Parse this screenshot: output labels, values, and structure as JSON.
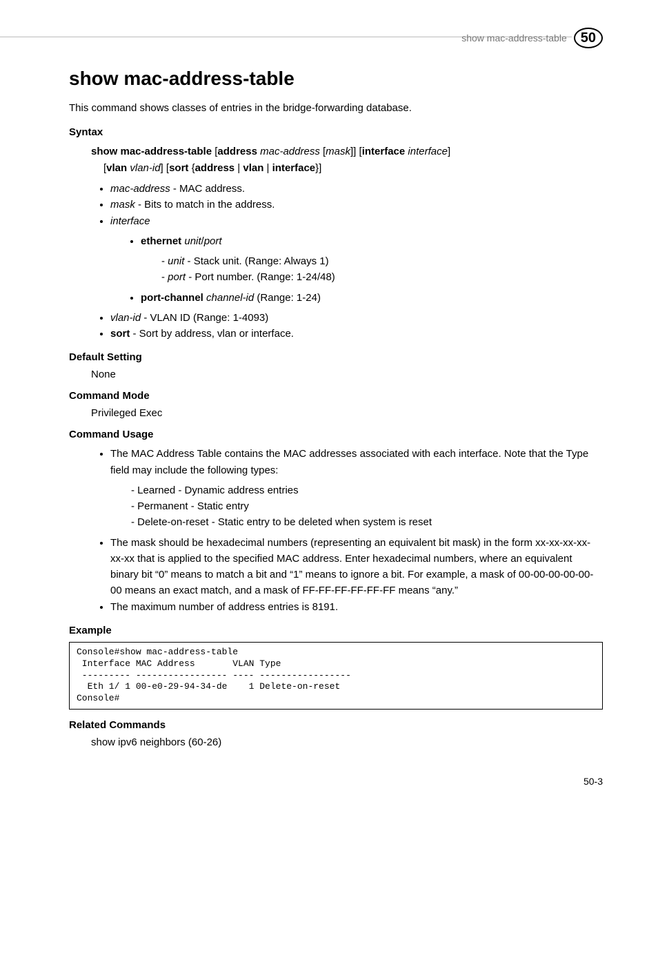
{
  "header": {
    "running_title": "show mac-address-table",
    "chapter_number": "50"
  },
  "title": "show mac-address-table",
  "intro": "This command shows classes of entries in the bridge-forwarding database.",
  "syntax": {
    "heading": "Syntax",
    "line1_b1": "show mac-address-table",
    "line1_t1": " [",
    "line1_b2": "address",
    "line1_t2": " ",
    "line1_i1": "mac-address",
    "line1_t3": " [",
    "line1_i2": "mask",
    "line1_t4": "]] [",
    "line1_b3": "interface",
    "line1_t5": " ",
    "line1_i3": "interface",
    "line1_t6": "]",
    "line2_t1": "[",
    "line2_b1": "vlan",
    "line2_t2": " ",
    "line2_i1": "vlan-id",
    "line2_t3": "] [",
    "line2_b2": "sort",
    "line2_t4": " {",
    "line2_b3": "address",
    "line2_t5": " | ",
    "line2_b4": "vlan",
    "line2_t6": " | ",
    "line2_b5": "interface",
    "line2_t7": "}]",
    "params": {
      "mac_address_i": "mac-address",
      "mac_address_t": " - MAC address.",
      "mask_i": "mask",
      "mask_t": " - Bits to match in the address.",
      "interface_i": "interface",
      "ethernet_b": "ethernet",
      "ethernet_sp": " ",
      "ethernet_i1": "unit",
      "ethernet_slash": "/",
      "ethernet_i2": "port",
      "unit_i": "unit",
      "unit_t": " - Stack unit. (Range: Always 1)",
      "port_i": "port",
      "port_t": " - Port number. (Range: 1-24/48)",
      "portchannel_b": "port-channel",
      "portchannel_sp": " ",
      "portchannel_i": "channel-id",
      "portchannel_t": " (Range: 1-24)",
      "vlanid_i": "vlan-id",
      "vlanid_t": " - VLAN ID (Range: 1-4093)",
      "sort_b": "sort",
      "sort_t": " - Sort by address, vlan or interface."
    }
  },
  "default_setting": {
    "heading": "Default Setting",
    "text": "None"
  },
  "command_mode": {
    "heading": "Command Mode",
    "text": "Privileged Exec"
  },
  "command_usage": {
    "heading": "Command Usage",
    "item1": "The MAC Address Table contains the MAC addresses associated with each interface. Note that the Type field may include the following types:",
    "sub1": "Learned - Dynamic address entries",
    "sub2": "Permanent - Static entry",
    "sub3": "Delete-on-reset - Static entry to be deleted when system is reset",
    "item2": "The mask should be hexadecimal numbers (representing an equivalent bit mask) in the form xx-xx-xx-xx-xx-xx that is applied to the specified MAC address. Enter hexadecimal numbers, where an equivalent binary bit “0” means to match a bit and “1” means to ignore a bit. For example, a mask of 00-00-00-00-00-00 means an exact match, and a mask of FF-FF-FF-FF-FF-FF means “any.”",
    "item3": "The maximum number of address entries is 8191."
  },
  "example": {
    "heading": "Example",
    "code": "Console#show mac-address-table\n Interface MAC Address       VLAN Type\n --------- ----------------- ---- -----------------\n  Eth 1/ 1 00-e0-29-94-34-de    1 Delete-on-reset\nConsole#"
  },
  "related": {
    "heading": "Related Commands",
    "text": "show ipv6 neighbors (60-26)"
  },
  "footer": "50-3"
}
